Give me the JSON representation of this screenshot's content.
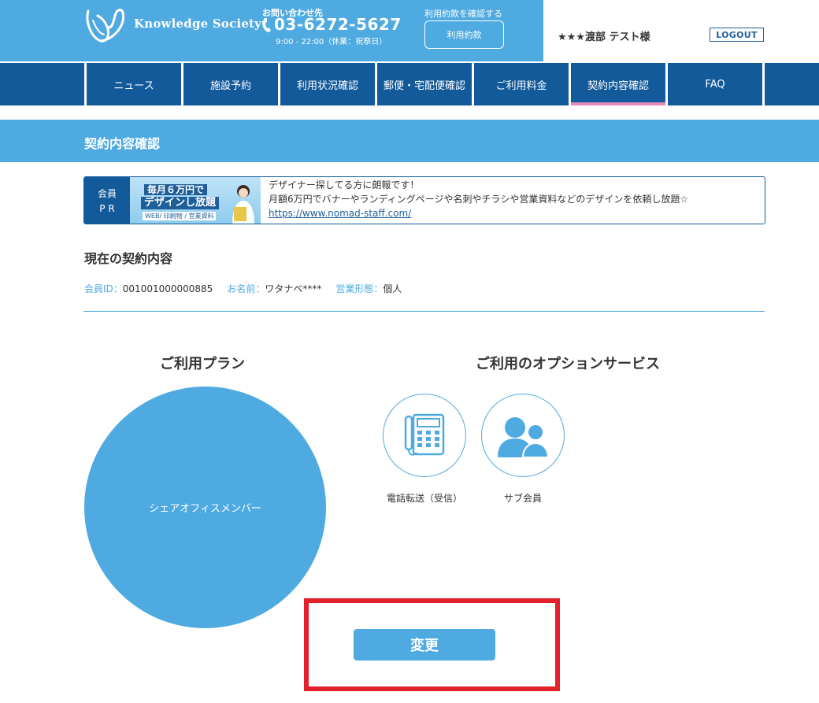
{
  "header": {
    "brand": "Knowledge Society",
    "contact_label": "お問い合わせ先",
    "phone": "03-6272-5627",
    "hours": "9:00 - 22:00（休業：祝祭日）",
    "terms_label": "利用約款を確認する",
    "terms_button": "利用約款",
    "user_name": "★★★渡部 テスト様",
    "logout": "LOGOUT"
  },
  "nav": {
    "items": [
      {
        "label": "ニュース"
      },
      {
        "label": "施設予約"
      },
      {
        "label": "利用状況確認"
      },
      {
        "label": "郵便・宅配便確認"
      },
      {
        "label": "ご利用料金"
      },
      {
        "label": "契約内容確認"
      },
      {
        "label": "FAQ"
      }
    ],
    "active": "契約内容確認"
  },
  "page_title": "契約内容確認",
  "pr": {
    "label_line1": "会員",
    "label_line2": "P R",
    "banner_line1": "毎月６万円で",
    "banner_line2": "デザインし放題",
    "banner_line3": "WEB/ 印刷物 / 営業資料",
    "text_line1": "デザイナー探してる方に朗報です！",
    "text_line2": "月額6万円でバナーやランディングページや名刺やチラシや営業資料などのデザインを依頼し放題☆",
    "link": "https://www.nomad-staff.com/"
  },
  "contract": {
    "section_title": "現在の契約内容",
    "member_id_label": "会員ID：",
    "member_id": "001001000000885",
    "name_label": "お名前：",
    "name": "ワタナベ****",
    "business_label": "営業形態：",
    "business": "個人"
  },
  "plan": {
    "title": "ご利用プラン",
    "name": "シェアオフィスメンバー"
  },
  "options": {
    "title": "ご利用のオプションサービス",
    "items": [
      {
        "label": "電話転送（受信）",
        "icon": "phone-icon"
      },
      {
        "label": "サブ会員",
        "icon": "sub-member-icon"
      }
    ]
  },
  "change_button": "変更",
  "colors": {
    "primary": "#4eaae0",
    "nav": "#135a9b",
    "active_underline": "#e58bbd",
    "highlight": "#e3202b"
  }
}
